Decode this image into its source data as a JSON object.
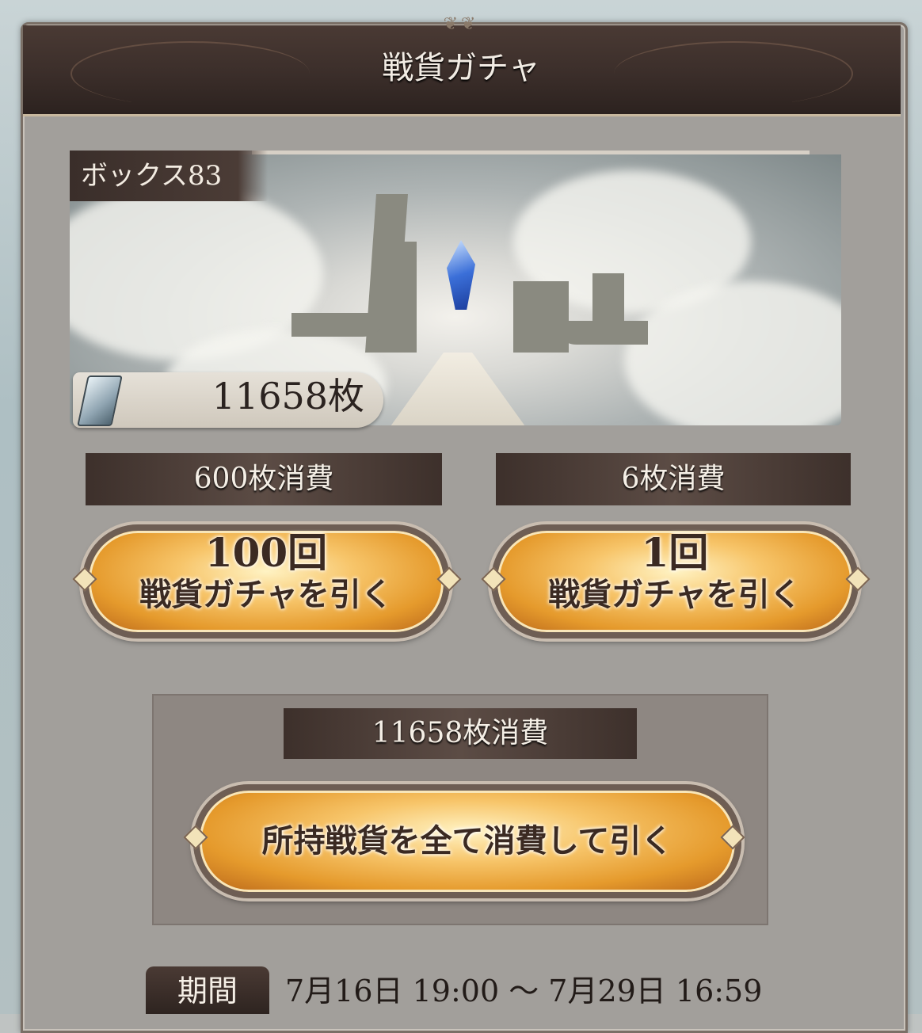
{
  "header": {
    "title": "戦貨ガチャ"
  },
  "box": {
    "label": "ボックス83",
    "ticket_count": "11658枚"
  },
  "gacha": [
    {
      "cost": "600枚消費",
      "count": "100回",
      "action": "戦貨ガチャを引く"
    },
    {
      "cost": "6枚消費",
      "count": "1回",
      "action": "戦貨ガチャを引く"
    }
  ],
  "all_gacha": {
    "cost": "11658枚消費",
    "action": "所持戦貨を全て消費して引く"
  },
  "period": {
    "label": "期間",
    "text": "7月16日 19:00 〜 7月29日 16:59"
  },
  "icons": {
    "ticket": "ticket-icon",
    "crystal": "crystal-icon"
  },
  "colors": {
    "accent_gold": "#e59a2c",
    "dark_brown": "#3b2e2a",
    "panel_gray": "#a29f9b"
  }
}
